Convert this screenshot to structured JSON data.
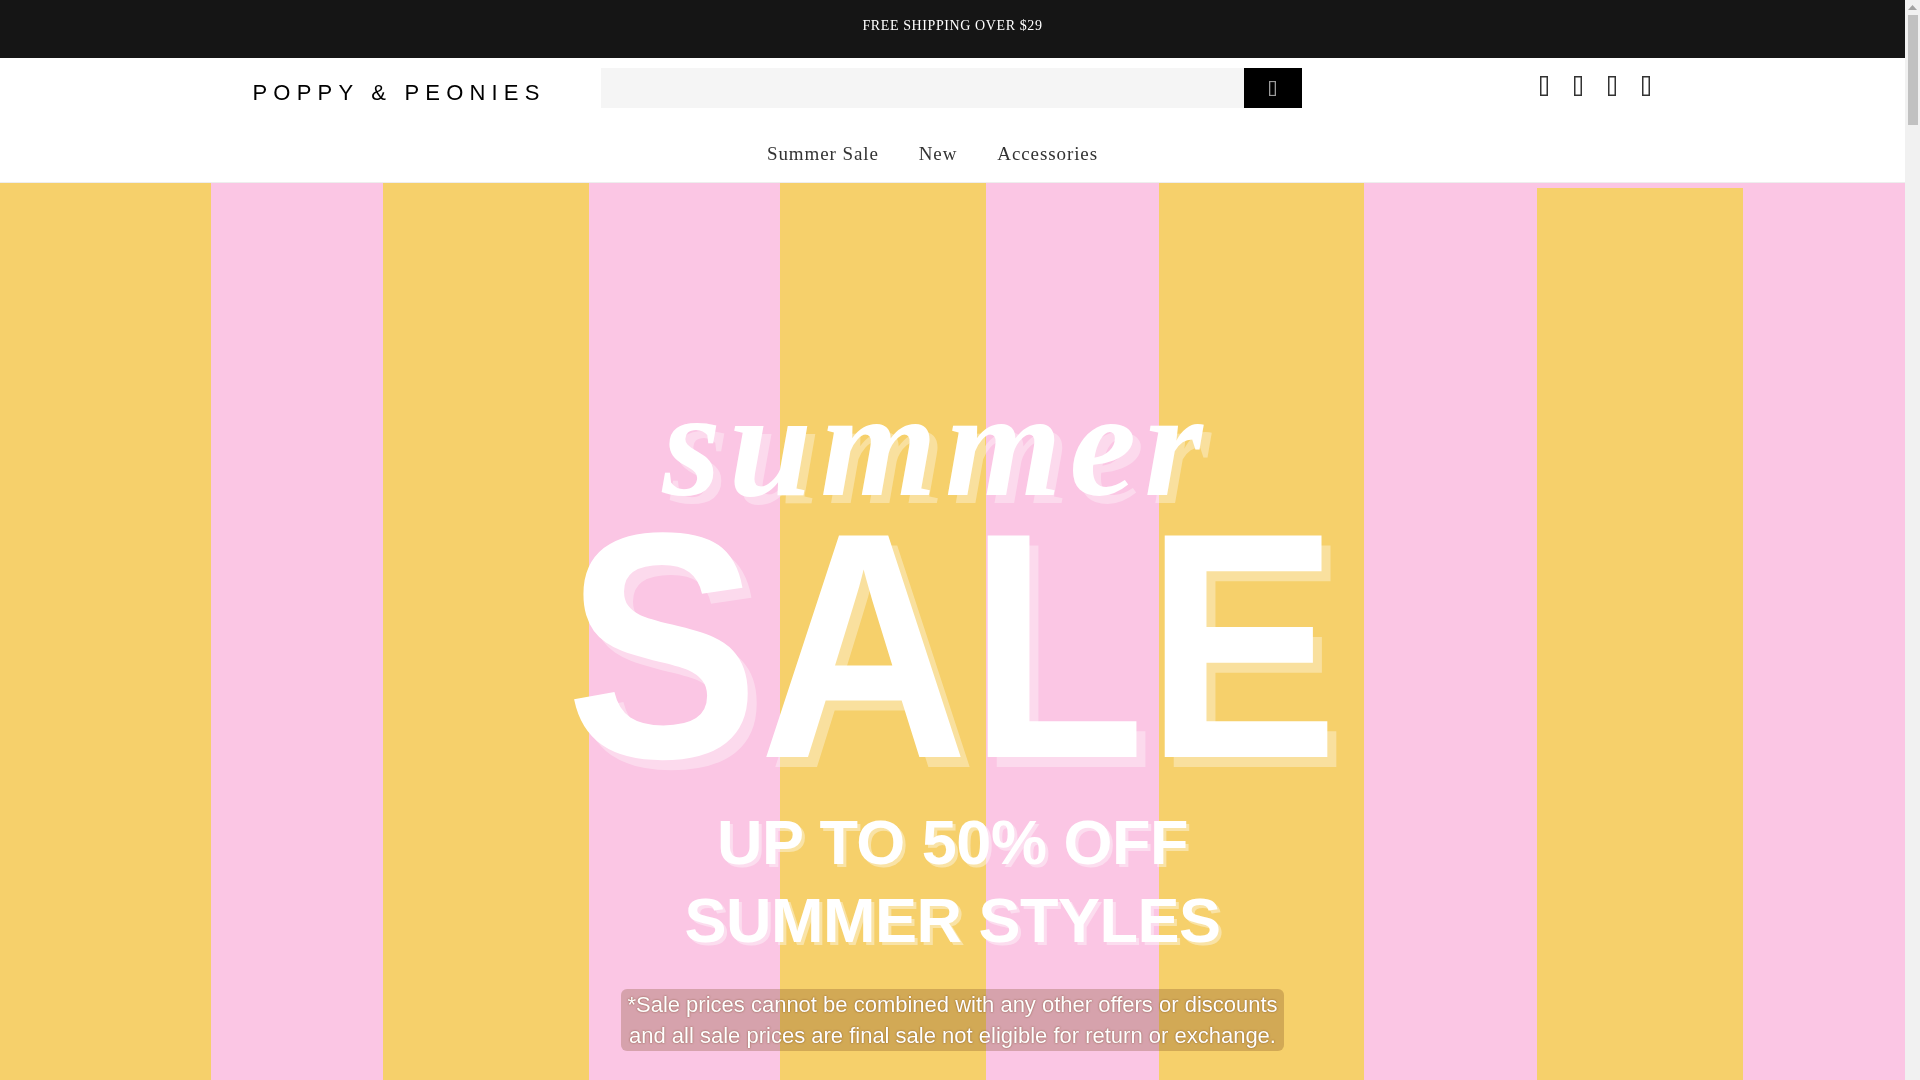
{
  "announcement_bar": {
    "text": "FREE SHIPPING OVER $29"
  },
  "header": {
    "logo": "POPPY & PEONIES",
    "nav": [
      "Summer Sale",
      "New",
      "Accessories"
    ]
  },
  "hero_banner": {
    "script_title": "summer",
    "title": "SALE",
    "headline_lines": [
      "UP TO 50% OFF",
      "SUMMER STYLES"
    ],
    "fine_print_lines": [
      "*Sale prices cannot be combined with any other offers or discounts",
      "and all sale prices are final sale not eligible for return or exchange."
    ]
  }
}
